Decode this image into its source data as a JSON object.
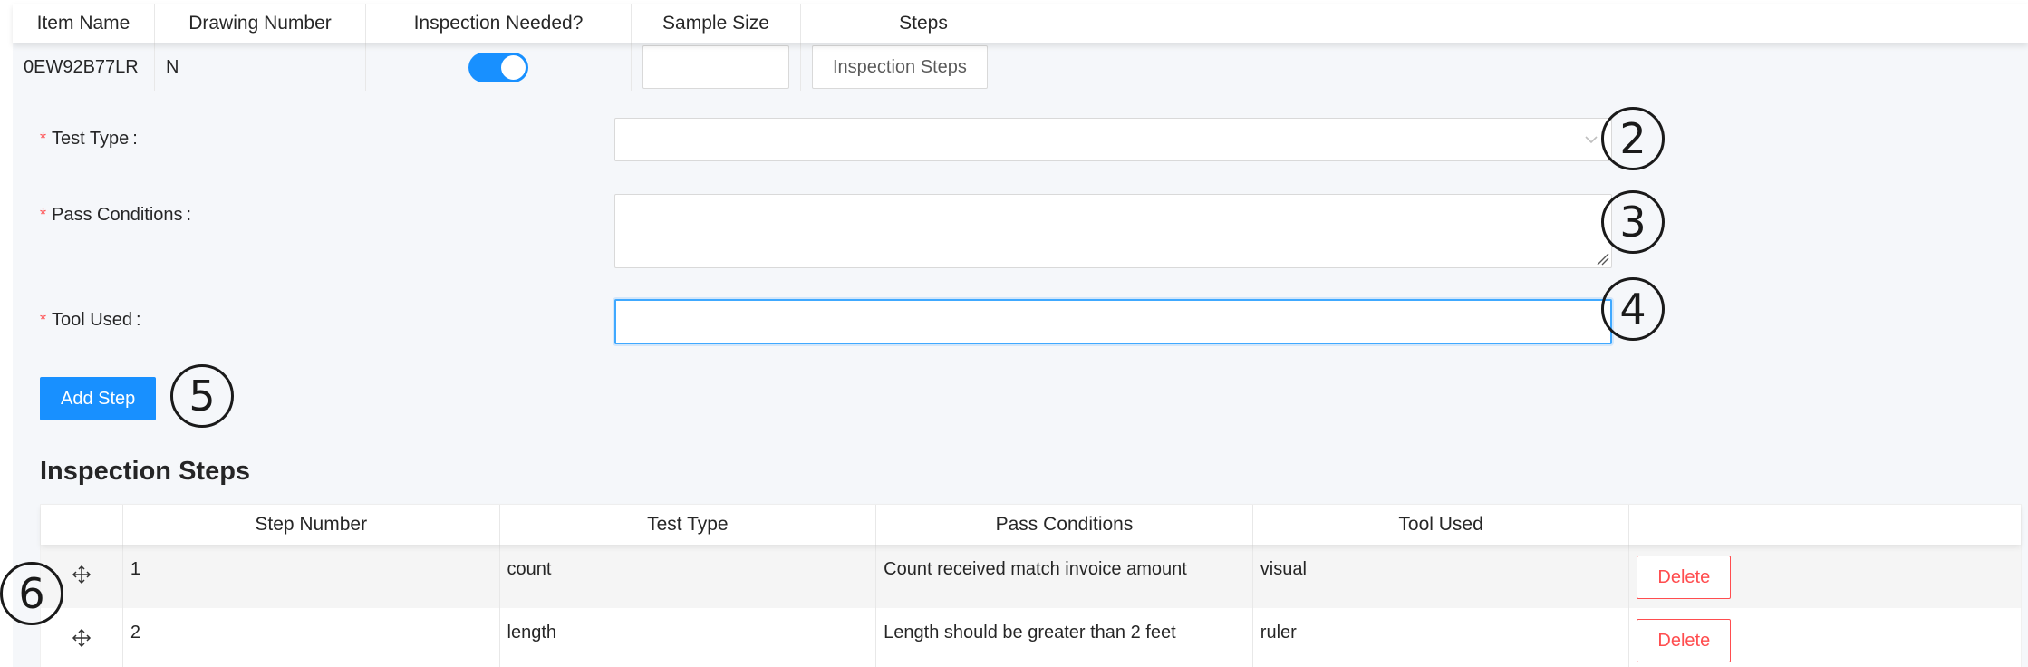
{
  "top_table": {
    "headers": [
      "Item Name",
      "Drawing Number",
      "Inspection Needed?",
      "Sample Size",
      "Steps"
    ],
    "row": {
      "item_name": "0EW92B77LR",
      "drawing_number": "N",
      "inspection_needed": true,
      "sample_size": "",
      "steps_button_label": "Inspection Steps"
    }
  },
  "form": {
    "test_type_label": "Test Type",
    "test_type_value": "",
    "pass_conditions_label": "Pass Conditions",
    "pass_conditions_value": "",
    "tool_used_label": "Tool Used",
    "tool_used_value": "",
    "required_mark": "*",
    "colon": ":",
    "add_step_label": "Add Step"
  },
  "steps_section": {
    "title": "Inspection Steps",
    "headers": [
      "",
      "Step Number",
      "Test Type",
      "Pass Conditions",
      "Tool Used",
      ""
    ],
    "rows": [
      {
        "step_number": "1",
        "test_type": "count",
        "pass_conditions": "Count received match invoice amount",
        "tool_used": "visual",
        "delete_label": "Delete"
      },
      {
        "step_number": "2",
        "test_type": "length",
        "pass_conditions": "Length should be greater than 2 feet",
        "tool_used": "ruler",
        "delete_label": "Delete"
      }
    ]
  },
  "callouts": [
    "2",
    "3",
    "4",
    "5",
    "6"
  ],
  "colors": {
    "primary": "#1890ff",
    "danger": "#ff4d4f",
    "form_background": "#f5f7fa"
  },
  "icons": {
    "select_arrow": "chevron-down-icon",
    "drag_handle": "drag-move-icon",
    "resize": "resize-grip-icon"
  }
}
